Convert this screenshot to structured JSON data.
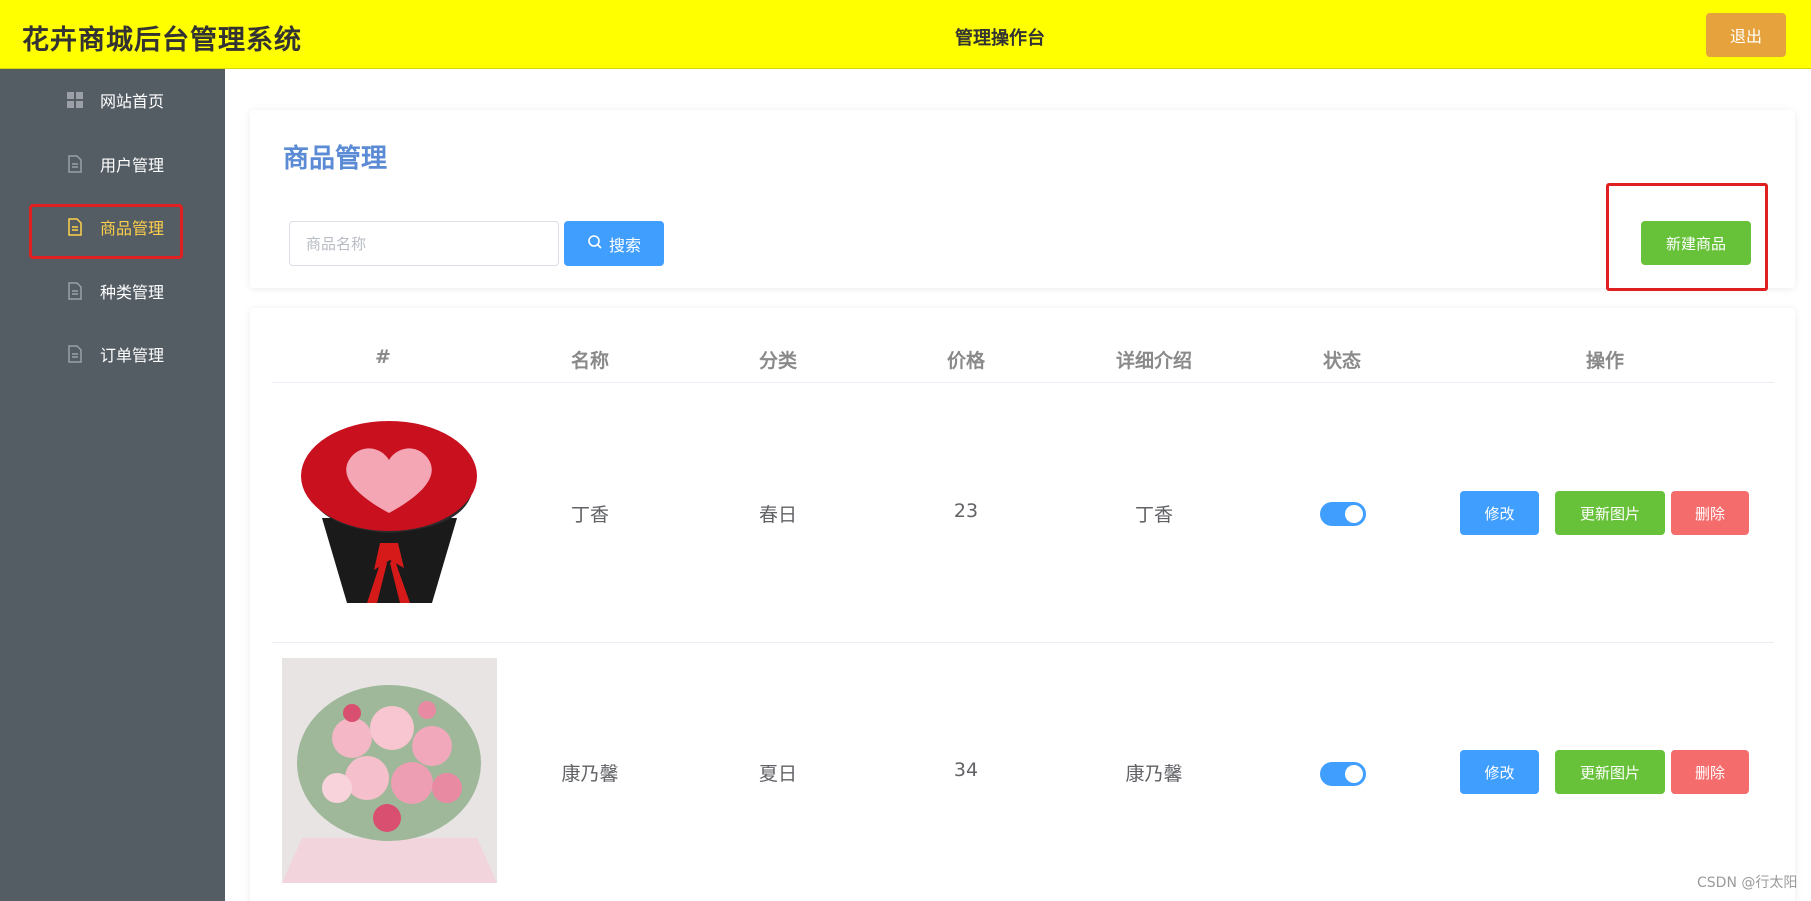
{
  "header": {
    "app_title": "花卉商城后台管理系统",
    "center_title": "管理操作台",
    "logout_label": "退出",
    "bg_color": "#ffff00"
  },
  "sidebar": {
    "items": [
      {
        "label": "网站首页",
        "icon": "grid-icon"
      },
      {
        "label": "用户管理",
        "icon": "document-icon"
      },
      {
        "label": "商品管理",
        "icon": "document-icon",
        "active": true
      },
      {
        "label": "种类管理",
        "icon": "document-icon"
      },
      {
        "label": "订单管理",
        "icon": "document-icon"
      }
    ]
  },
  "main": {
    "page_title": "商品管理",
    "search": {
      "placeholder": "商品名称",
      "button_label": "搜索"
    },
    "new_button_label": "新建商品",
    "table": {
      "headers": [
        "#",
        "名称",
        "分类",
        "价格",
        "详细介绍",
        "状态",
        "操作"
      ],
      "rows": [
        {
          "image": "red-rose-heart-bouquet",
          "name": "丁香",
          "category": "春日",
          "price": "23",
          "description": "丁香",
          "status_on": true,
          "actions": [
            "修改",
            "更新图片",
            "删除"
          ]
        },
        {
          "image": "pink-rose-bouquet",
          "name": "康乃馨",
          "category": "夏日",
          "price": "34",
          "description": "康乃馨",
          "status_on": true,
          "actions": [
            "修改",
            "更新图片",
            "删除"
          ]
        }
      ]
    }
  },
  "watermark": "CSDN @行太阳",
  "colors": {
    "primary": "#409eff",
    "success": "#67c23a",
    "danger": "#f56c6c",
    "warning": "#e6a23c",
    "sidebar": "#545c64",
    "highlight": "#e02020"
  }
}
